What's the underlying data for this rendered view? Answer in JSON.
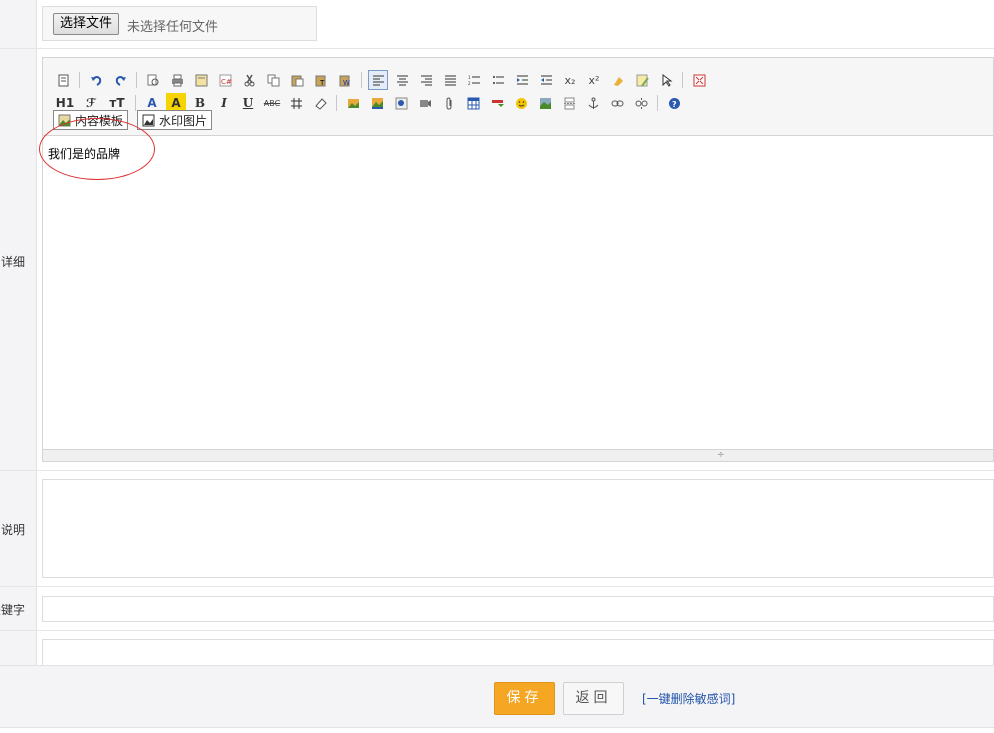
{
  "file": {
    "button_label": "选择文件",
    "status": "未选择任何文件"
  },
  "labels": {
    "detail": "详细：",
    "desc": "说明：",
    "keyword": "关键字："
  },
  "editor": {
    "row1_texts": {
      "sub": "x₂",
      "sup": "x²"
    },
    "row2_texts": {
      "heading": "H1",
      "fontfamily": "ℱ",
      "fontsize": "тT",
      "fontcolor": "A",
      "backcolor": "A",
      "bold": "B",
      "italic": "I",
      "underline": "U",
      "strike": "ABC"
    },
    "template_button": "内容模板",
    "watermark_button": "水印图片",
    "content": "我们是的品牌"
  },
  "footer": {
    "save": "保存",
    "back": "返回",
    "remove_words": "[一键删除敏感词]"
  },
  "colors": {
    "accent": "#f5a623",
    "link": "#2255aa",
    "annotation": "#e03030"
  }
}
